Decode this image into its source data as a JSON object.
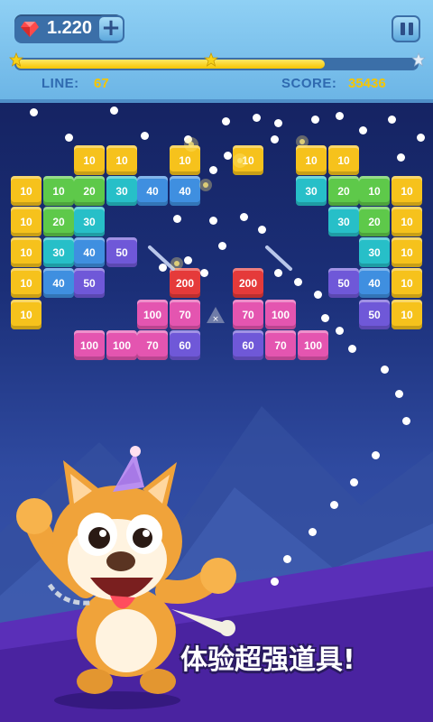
{
  "header": {
    "gems": "1.220",
    "add_label": "+",
    "line_label": "LINE:",
    "line_value": "67",
    "score_label": "SCORE:",
    "score_value": "35436",
    "level_progress": 0.77
  },
  "colors": {
    "yellow": "#f6c21c",
    "green": "#5ec94a",
    "teal": "#27bfc8",
    "blue": "#3f8fe0",
    "purple": "#6f58d8",
    "pink": "#e455b0",
    "red": "#e53a3a",
    "accent": "#f7c600"
  },
  "board": {
    "bricks": [
      {
        "t": "10",
        "c": "yellow"
      },
      {
        "t": "10",
        "c": "yellow"
      },
      {
        "t": "10",
        "c": "yellow"
      },
      {
        "t": "10",
        "c": "yellow"
      },
      {
        "t": "10",
        "c": "yellow"
      },
      {
        "t": "10",
        "c": "yellow"
      },
      {
        "t": "10",
        "c": "yellow"
      },
      {
        "t": "10",
        "c": "green"
      },
      {
        "t": "20",
        "c": "green"
      },
      {
        "t": "30",
        "c": "teal"
      },
      {
        "t": "40",
        "c": "blue"
      },
      {
        "t": "40",
        "c": "blue"
      },
      {
        "t": "30",
        "c": "teal"
      },
      {
        "t": "20",
        "c": "green"
      },
      {
        "t": "10",
        "c": "green"
      },
      {
        "t": "10",
        "c": "yellow"
      },
      {
        "t": "10",
        "c": "yellow"
      },
      {
        "t": "20",
        "c": "green"
      },
      {
        "t": "30",
        "c": "teal"
      },
      {
        "t": "30",
        "c": "teal"
      },
      {
        "t": "20",
        "c": "green"
      },
      {
        "t": "10",
        "c": "yellow"
      },
      {
        "t": "10",
        "c": "yellow"
      },
      {
        "t": "30",
        "c": "teal"
      },
      {
        "t": "40",
        "c": "blue"
      },
      {
        "t": "50",
        "c": "purple"
      },
      {
        "t": "30",
        "c": "teal"
      },
      {
        "t": "10",
        "c": "yellow"
      },
      {
        "t": "10",
        "c": "yellow"
      },
      {
        "t": "40",
        "c": "blue"
      },
      {
        "t": "50",
        "c": "purple"
      },
      {
        "t": "200",
        "c": "red"
      },
      {
        "t": "200",
        "c": "red"
      },
      {
        "t": "50",
        "c": "purple"
      },
      {
        "t": "40",
        "c": "blue"
      },
      {
        "t": "10",
        "c": "yellow"
      },
      {
        "t": "10",
        "c": "yellow"
      },
      {
        "t": "100",
        "c": "pink"
      },
      {
        "t": "70",
        "c": "pink"
      },
      {
        "t": "70",
        "c": "pink"
      },
      {
        "t": "100",
        "c": "pink"
      },
      {
        "t": "50",
        "c": "purple"
      },
      {
        "t": "10",
        "c": "yellow"
      },
      {
        "t": "100",
        "c": "pink"
      },
      {
        "t": "100",
        "c": "pink"
      },
      {
        "t": "70",
        "c": "pink"
      },
      {
        "t": "60",
        "c": "purple"
      },
      {
        "t": "60",
        "c": "purple"
      },
      {
        "t": "70",
        "c": "pink"
      },
      {
        "t": "100",
        "c": "pink"
      }
    ]
  },
  "mascot": {
    "icon": "shiba-dog-party-mascot"
  },
  "slogan": "体验超强道具!"
}
